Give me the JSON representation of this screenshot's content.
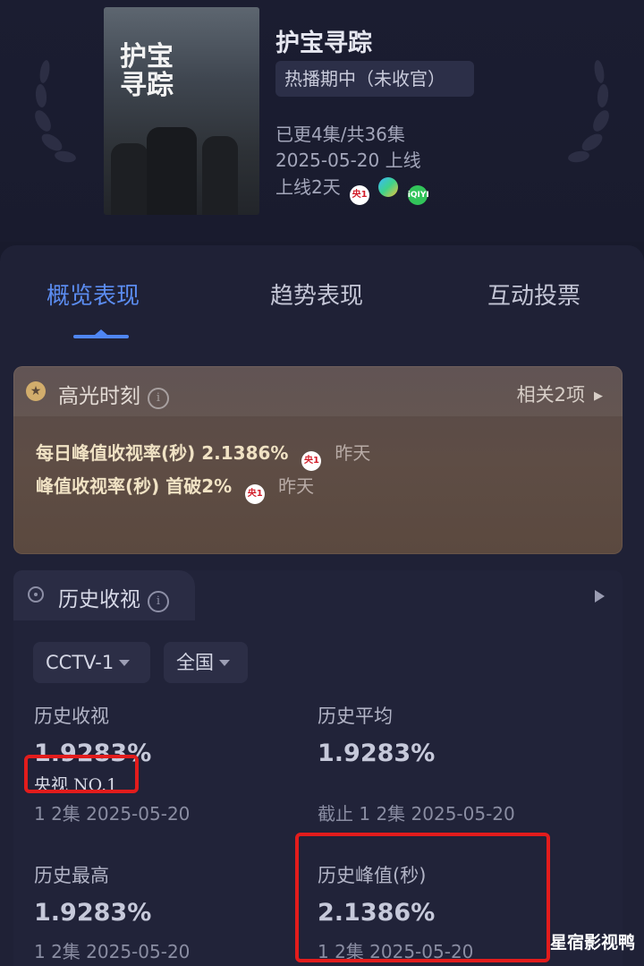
{
  "show": {
    "poster_title": "护宝寻踪",
    "title": "护宝寻踪",
    "status": "热播期中（未收官）",
    "episodes": "已更4集/共36集",
    "release": "2025-05-20 上线",
    "online_days": "上线2天",
    "channels": [
      {
        "icon": "cctv1-icon",
        "text": "央1"
      },
      {
        "icon": "video-platform-icon",
        "text": ""
      },
      {
        "icon": "iqiyi-icon",
        "text": "iQIYI"
      }
    ]
  },
  "tabs": [
    "概览表现",
    "趋势表现",
    "互动投票"
  ],
  "highlight": {
    "title": "高光时刻",
    "info": "i",
    "related": "相关2项",
    "related_arrow": "▶",
    "items": [
      {
        "label": "每日峰值收视率(秒)",
        "value": "2.1386%",
        "channel": "央1",
        "time": "昨天"
      },
      {
        "label": "峰值收视率(秒)",
        "value": "首破2%",
        "channel": "央1",
        "time": "昨天"
      }
    ]
  },
  "history": {
    "title": "历史收视",
    "info": "i",
    "filters": {
      "channel": "CCTV-1",
      "region": "全国"
    },
    "stats": [
      {
        "label": "历史收视",
        "value": "1.9283%",
        "rank": "央视 NO.1",
        "sub": "1 2集 2025-05-20"
      },
      {
        "label": "历史平均",
        "value": "1.9283%",
        "sub": "截止 1 2集 2025-05-20"
      },
      {
        "label": "历史最高",
        "value": "1.9283%",
        "sub": "1 2集 2025-05-20"
      },
      {
        "label": "历史峰值(秒)",
        "value": "2.1386%",
        "sub": "1 2集 2025-05-20"
      }
    ]
  },
  "watermark": "星宿影视鸭",
  "colors": {
    "accent": "#4f86f3",
    "highlight_box": "#e21c1c",
    "background": "#181a2c"
  }
}
